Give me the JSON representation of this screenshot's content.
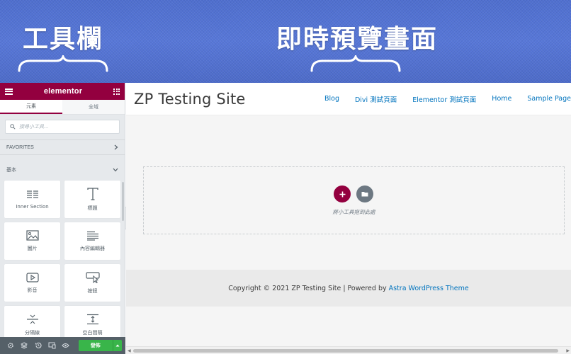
{
  "banner": {
    "left_label": "工具欄",
    "right_label": "即時預覽畫面"
  },
  "editor": {
    "logo": "elementor",
    "tabs": [
      {
        "label": "元素",
        "active": true
      },
      {
        "label": "全域",
        "active": false
      }
    ],
    "search": {
      "placeholder": "搜尋小工具..."
    },
    "sections": [
      {
        "label": "FAVORITES",
        "state": "collapsed"
      },
      {
        "label": "基本",
        "state": "expanded"
      }
    ],
    "widgets": [
      {
        "label": "Inner Section",
        "icon": "inner-section-icon"
      },
      {
        "label": "標題",
        "icon": "heading-icon"
      },
      {
        "label": "圖片",
        "icon": "image-icon"
      },
      {
        "label": "內容編輯器",
        "icon": "text-editor-icon"
      },
      {
        "label": "影音",
        "icon": "video-icon"
      },
      {
        "label": "按鈕",
        "icon": "button-icon"
      },
      {
        "label": "分隔線",
        "icon": "divider-icon"
      },
      {
        "label": "空白間隔",
        "icon": "spacer-icon"
      }
    ],
    "footer": {
      "icons": [
        "settings-icon",
        "navigator-icon",
        "history-icon",
        "responsive-icon",
        "preview-eye-icon"
      ],
      "publish_label": "發佈"
    },
    "colors": {
      "brand": "#93003f",
      "publish": "#39b54a",
      "panel_bg": "#e6e9ec",
      "footer_bg": "#556068"
    }
  },
  "site": {
    "title": "ZP Testing Site",
    "nav": [
      "Blog",
      "Divi 測試頁面",
      "Elementor 測試頁面",
      "Home",
      "Sample Page"
    ],
    "drop_text": "將小工具拖到此處",
    "footer": {
      "prefix": "Copyright © 2021 ZP Testing Site | Powered by",
      "link": "Astra WordPress Theme"
    },
    "link_color": "#0274be"
  }
}
